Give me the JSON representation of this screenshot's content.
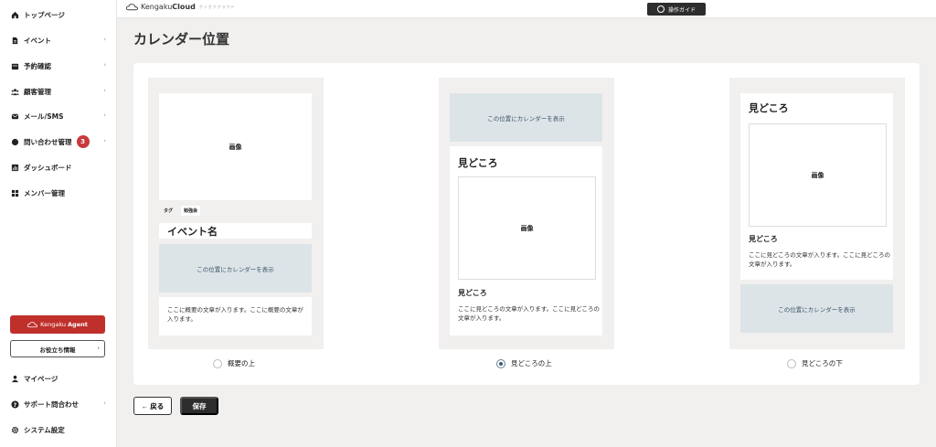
{
  "sidebar": {
    "items": [
      {
        "label": "トップページ",
        "icon": "home-icon"
      },
      {
        "label": "イベント",
        "icon": "document-icon",
        "chevron": "›"
      },
      {
        "label": "予約確認",
        "icon": "calendar-icon",
        "chevron": "›"
      },
      {
        "label": "顧客管理",
        "icon": "users-icon",
        "chevron": "›"
      },
      {
        "label": "メール/SMS",
        "icon": "mail-icon",
        "chevron": "›"
      },
      {
        "label": "問い合わせ管理",
        "icon": "chat-icon",
        "chevron": "›",
        "badge": "3"
      },
      {
        "label": "ダッシュボード",
        "icon": "chart-icon"
      },
      {
        "label": "メンバー管理",
        "icon": "grid-icon"
      }
    ],
    "agent_button": {
      "prefix": "Kengaku",
      "bold": "Agent"
    },
    "tips_button": {
      "label": "お役立ち情報",
      "chevron": "›"
    },
    "bottom_items": [
      {
        "label": "マイページ",
        "icon": "user-icon"
      },
      {
        "label": "サポート問合わせ",
        "icon": "help-icon",
        "chevron": "›"
      },
      {
        "label": "システム設定",
        "icon": "gear-icon"
      }
    ]
  },
  "header": {
    "logo_text": "Kengaku",
    "logo_bold": "Cloud",
    "logo_tag": "ケンガククラウド",
    "guide_label": "操作ガイド"
  },
  "page": {
    "title": "カレンダー位置"
  },
  "options": [
    {
      "image_label": "画像",
      "tags": [
        "タグ",
        "勉強会"
      ],
      "event_name": "イベント名",
      "calendar_label": "この位置にカレンダーを表示",
      "body": "ここに概要の文章が入ります。ここに概要の文章が入ります。",
      "radio_label": "概要の上",
      "selected": false
    },
    {
      "calendar_label": "この位置にカレンダーを表示",
      "section_title": "見どころ",
      "image_label": "画像",
      "sub_title": "見どころ",
      "body": "ここに見どころの文章が入ります。ここに見どころの文章が入ります。",
      "radio_label": "見どころの上",
      "selected": true
    },
    {
      "section_title": "見どころ",
      "image_label": "画像",
      "sub_title": "見どころ",
      "body": "ここに見どころの文章が入ります。ここに見どころの文章が入ります。",
      "calendar_label": "この位置にカレンダーを表示",
      "radio_label": "見どころの下",
      "selected": false
    }
  ],
  "actions": {
    "back_label": "← 戻る",
    "save_label": "保存"
  },
  "colors": {
    "accent_red": "#c0302b",
    "dark": "#2d2d2d",
    "calendar_bg": "#dde4e8",
    "badge_red": "#c9393b"
  }
}
